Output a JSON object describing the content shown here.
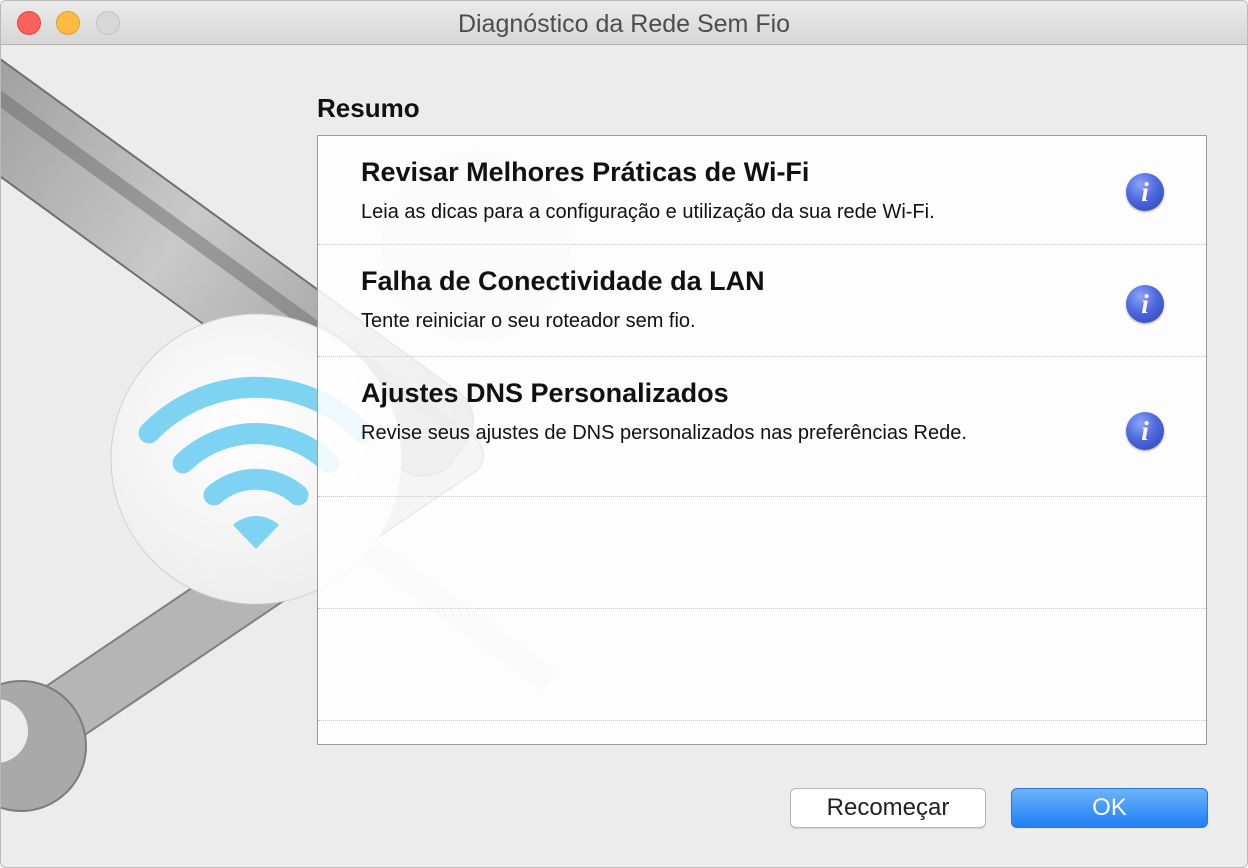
{
  "window": {
    "title": "Diagnóstico da Rede Sem Fio"
  },
  "summary": {
    "heading": "Resumo",
    "items": [
      {
        "title": "Revisar Melhores Práticas de Wi-Fi",
        "description": "Leia as dicas para a configuração e utilização da sua rede Wi-Fi.",
        "icon": "info-icon"
      },
      {
        "title": "Falha de Conectividade da LAN",
        "description": "Tente reiniciar o seu roteador sem fio.",
        "icon": "info-icon"
      },
      {
        "title": "Ajustes DNS Personalizados",
        "description": "Revise seus ajustes de DNS personalizados nas preferências Rede.",
        "icon": "info-icon"
      }
    ]
  },
  "buttons": {
    "restart": "Recomeçar",
    "ok": "OK"
  },
  "colors": {
    "accent": "#1f7ff5",
    "info_icon": "#3f58d0",
    "wifi": "#7fd3f2"
  }
}
